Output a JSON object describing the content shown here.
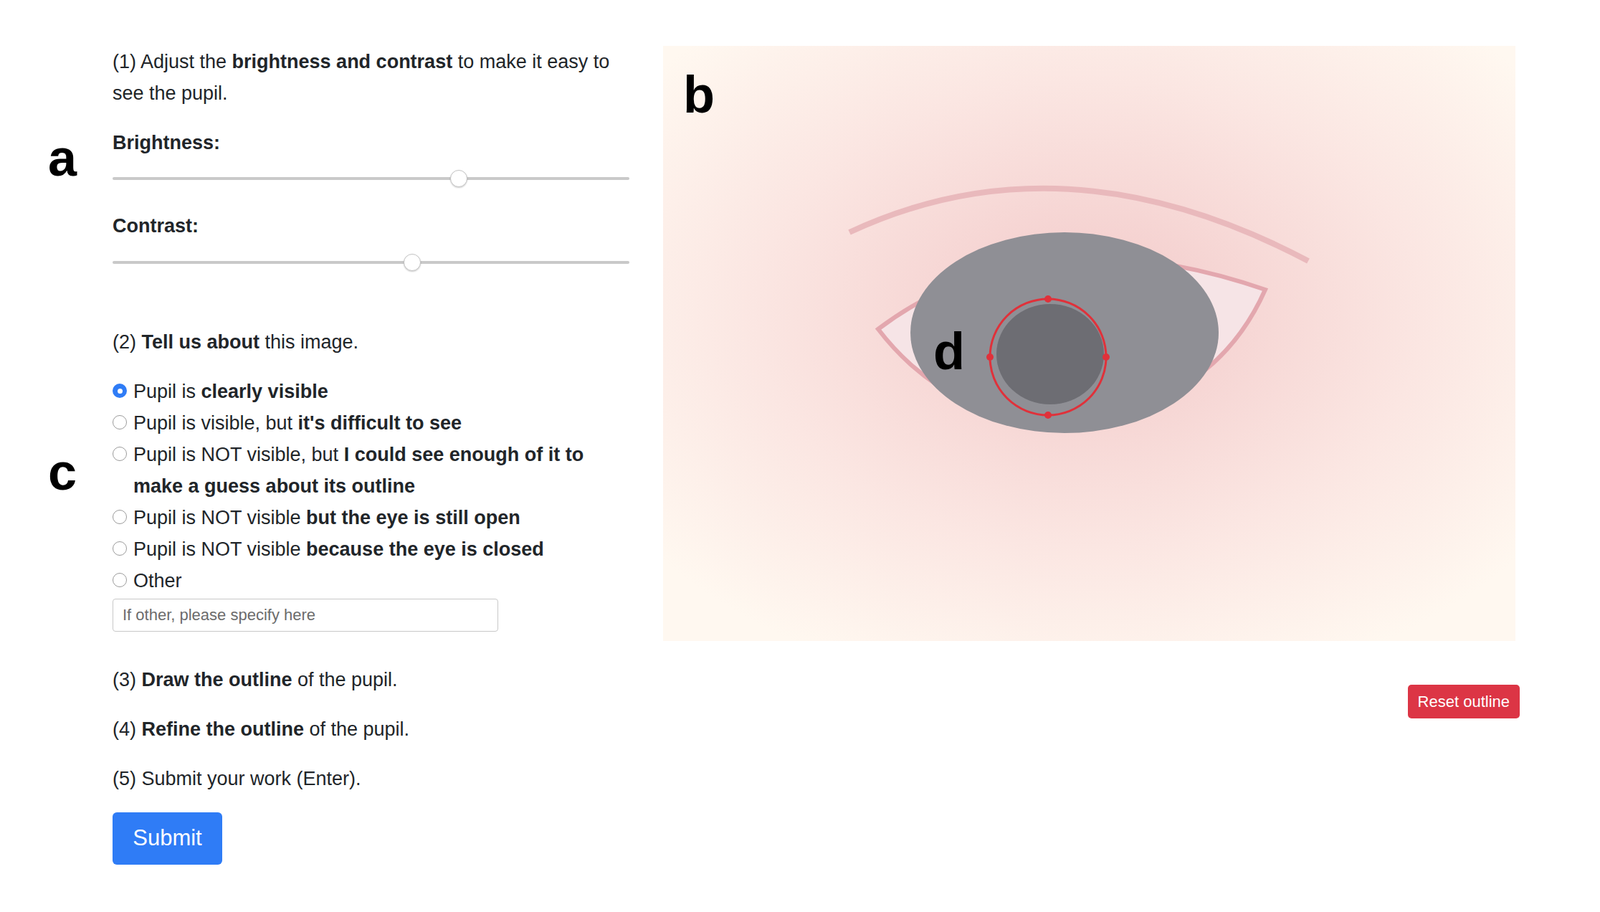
{
  "adjust": {
    "label": "a",
    "instruction": [
      {
        "text": "(1) Adjust the ",
        "bold": false
      },
      {
        "text": "brightness and contrast",
        "bold": true
      },
      {
        "text": " to make it easy to see the pupil.",
        "bold": false
      }
    ],
    "sliders": [
      {
        "name": "Brightness:",
        "level": 0.67
      },
      {
        "name": "Contrast:",
        "level": 0.58
      }
    ]
  },
  "describe": {
    "label": "c",
    "instruction": [
      {
        "text": "(2) ",
        "bold": false
      },
      {
        "text": "Tell us about",
        "bold": true
      },
      {
        "text": " this image.",
        "bold": false
      }
    ],
    "options": [
      {
        "segments": [
          {
            "text": "Pupil is ",
            "bold": false
          },
          {
            "text": "clearly visible",
            "bold": true
          }
        ],
        "selected": true
      },
      {
        "segments": [
          {
            "text": "Pupil is visible, but ",
            "bold": false
          },
          {
            "text": "it's difficult to see",
            "bold": true
          }
        ],
        "selected": false
      },
      {
        "segments": [
          {
            "text": "Pupil is NOT visible, but ",
            "bold": false
          },
          {
            "text": "I could see enough of it to make a guess about its outline",
            "bold": true
          }
        ],
        "selected": false
      },
      {
        "segments": [
          {
            "text": "Pupil is NOT visible ",
            "bold": false
          },
          {
            "text": "but the eye is still open",
            "bold": true
          }
        ],
        "selected": false
      },
      {
        "segments": [
          {
            "text": "Pupil is NOT visible ",
            "bold": false
          },
          {
            "text": "because the eye is closed",
            "bold": true
          }
        ],
        "selected": false
      },
      {
        "segments": [
          {
            "text": "Other",
            "bold": false
          }
        ],
        "selected": false
      }
    ],
    "other_field": {
      "placeholder": "If other, please specify here",
      "value": ""
    }
  },
  "steps": [
    [
      {
        "text": "(3) ",
        "bold": false
      },
      {
        "text": "Draw the outline",
        "bold": true
      },
      {
        "text": " of the pupil.",
        "bold": false
      }
    ],
    [
      {
        "text": "(4) ",
        "bold": false
      },
      {
        "text": "Refine the outline",
        "bold": true
      },
      {
        "text": " of the pupil.",
        "bold": false
      }
    ],
    [
      {
        "text": "(5) Submit your work (Enter).",
        "bold": false
      }
    ]
  ],
  "submit_button": "Submit",
  "image": {
    "label": "b",
    "outline": {
      "label": "d"
    }
  },
  "reset_button": "Reset outline"
}
